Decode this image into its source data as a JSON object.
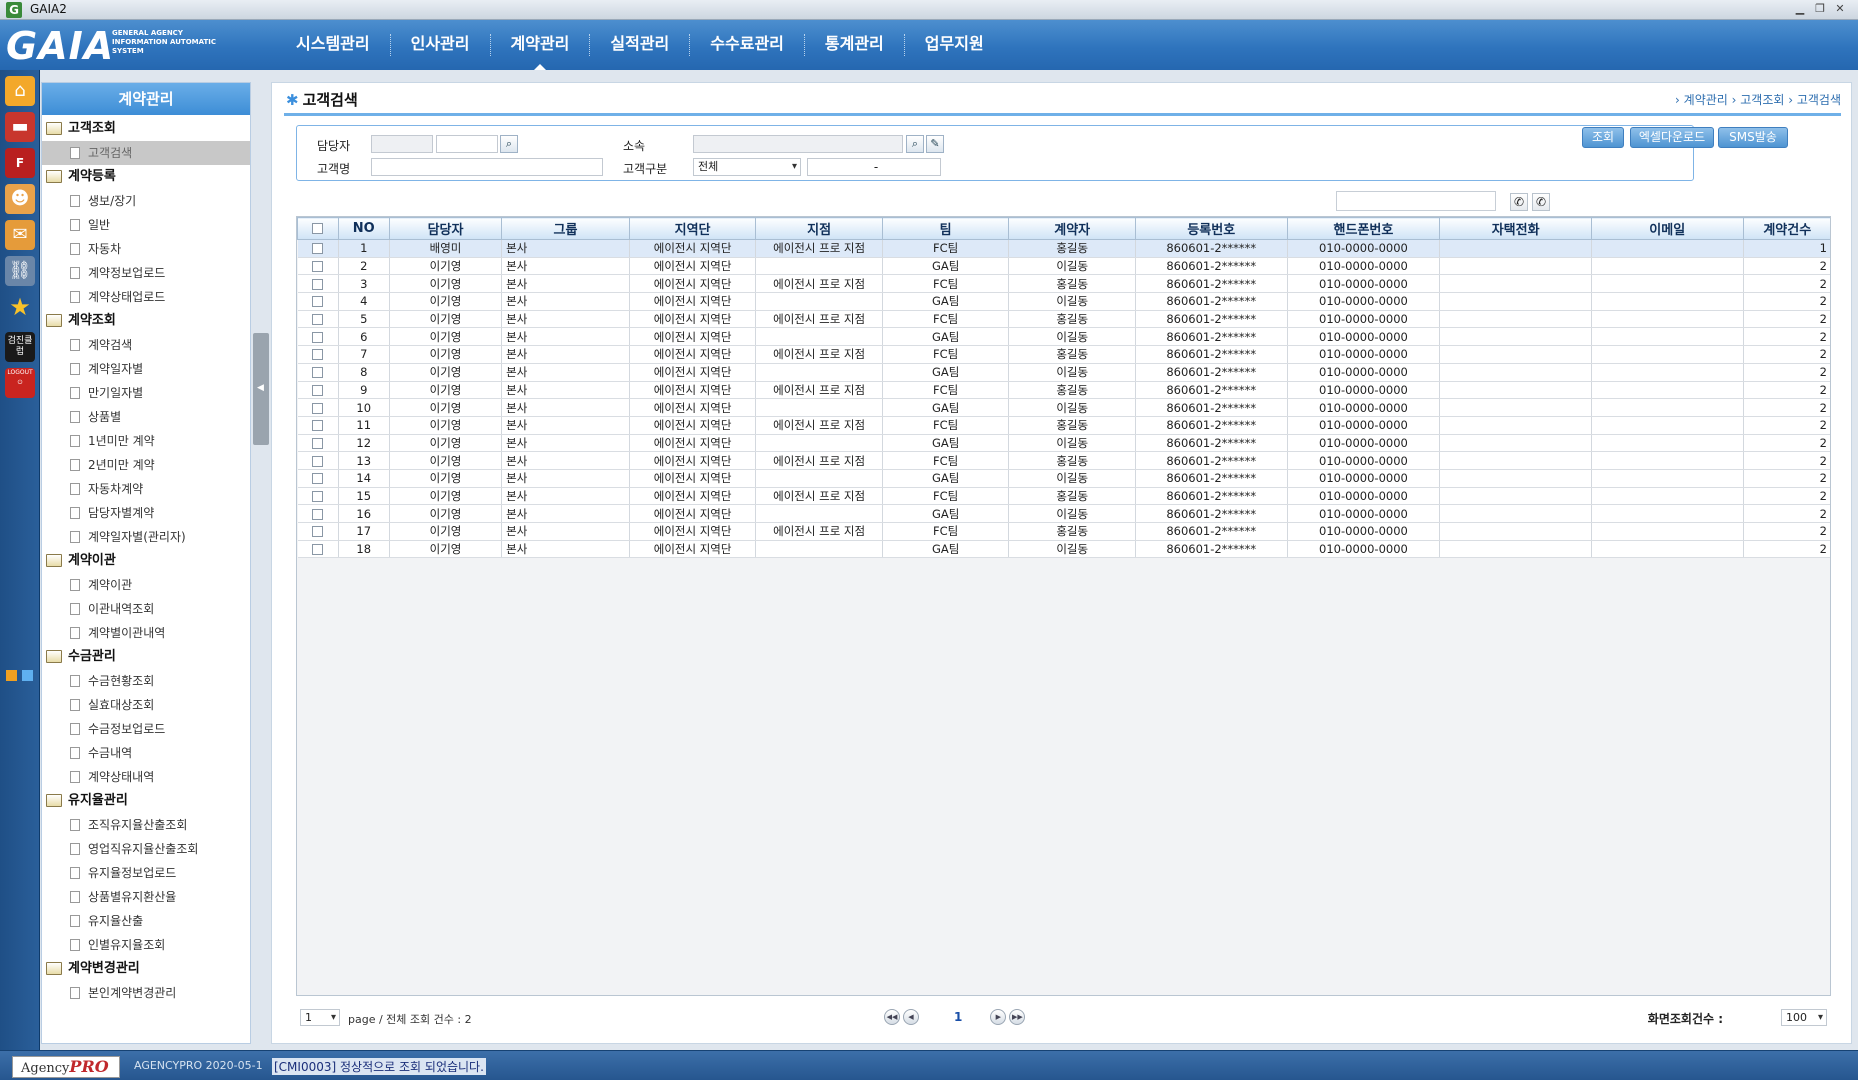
{
  "window": {
    "title": "GAIA2",
    "app_icon": "G"
  },
  "header": {
    "logo_text": "GAIA",
    "logo_sub": [
      "GENERAL AGENCY",
      "INFORMATION AUTOMATIC",
      "SYSTEM"
    ],
    "nav": [
      "시스템관리",
      "인사관리",
      "계약관리",
      "실적관리",
      "수수료관리",
      "통계관리",
      "업무지원"
    ],
    "active_nav": "계약관리"
  },
  "left_icons": [
    "home-icon",
    "car-icon",
    "fm-icon",
    "people-icon",
    "mail-icon",
    "link-icon",
    "star-icon",
    "exam-icon",
    "logout-icon"
  ],
  "left_icon_labels": {
    "exam": "검진클럽",
    "logout": "LOGOUT"
  },
  "sidebar": {
    "title": "계약관리",
    "groups": [
      {
        "label": "고객조회",
        "items": [
          "고객검색"
        ]
      },
      {
        "label": "계약등록",
        "items": [
          "생보/장기",
          "일반",
          "자동차",
          "계약정보업로드",
          "계약상태업로드"
        ]
      },
      {
        "label": "계약조회",
        "items": [
          "계약검색",
          "계약일자별",
          "만기일자별",
          "상품별",
          "1년미만 계약",
          "2년미만 계약",
          "자동차계약",
          "담당자별계약",
          "계약일자별(관리자)"
        ]
      },
      {
        "label": "계약이관",
        "items": [
          "계약이관",
          "이관내역조회",
          "계약별이관내역"
        ]
      },
      {
        "label": "수금관리",
        "items": [
          "수금현황조회",
          "실효대상조회",
          "수금정보업로드",
          "수금내역",
          "계약상태내역"
        ]
      },
      {
        "label": "유지율관리",
        "items": [
          "조직유지율산출조회",
          "영업직유지율산출조회",
          "유지율정보업로드",
          "상품별유지환산율",
          "유지율산출",
          "인별유지율조회"
        ]
      },
      {
        "label": "계약변경관리",
        "items": [
          "본인계약변경관리"
        ]
      }
    ],
    "selected": "고객검색"
  },
  "page": {
    "title": "고객검색",
    "breadcrumb": "› 계약관리 › 고객조회 › 고객검색"
  },
  "search": {
    "manager_label": "담당자",
    "affiliation_label": "소속",
    "customer_name_label": "고객명",
    "customer_type_label": "고객구분",
    "customer_type_value": "전체",
    "dash": "-",
    "buttons": {
      "search": "조회",
      "excel": "엑셀다운로드",
      "sms": "SMS발송"
    }
  },
  "table": {
    "columns": [
      "NO",
      "담당자",
      "그룹",
      "지역단",
      "지점",
      "팀",
      "계약자",
      "등록번호",
      "핸드폰번호",
      "자택전화",
      "이메일",
      "계약건수"
    ],
    "rows": [
      [
        "1",
        "배영미",
        "본사",
        "에이전시 지역단",
        "에이전시 프로 지점",
        "FC팀",
        "홍길동",
        "860601-2******",
        "010-0000-0000",
        "",
        "",
        "1"
      ],
      [
        "2",
        "이기영",
        "본사",
        "에이전시 지역단",
        "",
        "GA팀",
        "이길동",
        "860601-2******",
        "010-0000-0000",
        "",
        "",
        "2"
      ],
      [
        "3",
        "이기영",
        "본사",
        "에이전시 지역단",
        "에이전시 프로 지점",
        "FC팀",
        "홍길동",
        "860601-2******",
        "010-0000-0000",
        "",
        "",
        "2"
      ],
      [
        "4",
        "이기영",
        "본사",
        "에이전시 지역단",
        "",
        "GA팀",
        "이길동",
        "860601-2******",
        "010-0000-0000",
        "",
        "",
        "2"
      ],
      [
        "5",
        "이기영",
        "본사",
        "에이전시 지역단",
        "에이전시 프로 지점",
        "FC팀",
        "홍길동",
        "860601-2******",
        "010-0000-0000",
        "",
        "",
        "2"
      ],
      [
        "6",
        "이기영",
        "본사",
        "에이전시 지역단",
        "",
        "GA팀",
        "이길동",
        "860601-2******",
        "010-0000-0000",
        "",
        "",
        "2"
      ],
      [
        "7",
        "이기영",
        "본사",
        "에이전시 지역단",
        "에이전시 프로 지점",
        "FC팀",
        "홍길동",
        "860601-2******",
        "010-0000-0000",
        "",
        "",
        "2"
      ],
      [
        "8",
        "이기영",
        "본사",
        "에이전시 지역단",
        "",
        "GA팀",
        "이길동",
        "860601-2******",
        "010-0000-0000",
        "",
        "",
        "2"
      ],
      [
        "9",
        "이기영",
        "본사",
        "에이전시 지역단",
        "에이전시 프로 지점",
        "FC팀",
        "홍길동",
        "860601-2******",
        "010-0000-0000",
        "",
        "",
        "2"
      ],
      [
        "10",
        "이기영",
        "본사",
        "에이전시 지역단",
        "",
        "GA팀",
        "이길동",
        "860601-2******",
        "010-0000-0000",
        "",
        "",
        "2"
      ],
      [
        "11",
        "이기영",
        "본사",
        "에이전시 지역단",
        "에이전시 프로 지점",
        "FC팀",
        "홍길동",
        "860601-2******",
        "010-0000-0000",
        "",
        "",
        "2"
      ],
      [
        "12",
        "이기영",
        "본사",
        "에이전시 지역단",
        "",
        "GA팀",
        "이길동",
        "860601-2******",
        "010-0000-0000",
        "",
        "",
        "2"
      ],
      [
        "13",
        "이기영",
        "본사",
        "에이전시 지역단",
        "에이전시 프로 지점",
        "FC팀",
        "홍길동",
        "860601-2******",
        "010-0000-0000",
        "",
        "",
        "2"
      ],
      [
        "14",
        "이기영",
        "본사",
        "에이전시 지역단",
        "",
        "GA팀",
        "이길동",
        "860601-2******",
        "010-0000-0000",
        "",
        "",
        "2"
      ],
      [
        "15",
        "이기영",
        "본사",
        "에이전시 지역단",
        "에이전시 프로 지점",
        "FC팀",
        "홍길동",
        "860601-2******",
        "010-0000-0000",
        "",
        "",
        "2"
      ],
      [
        "16",
        "이기영",
        "본사",
        "에이전시 지역단",
        "",
        "GA팀",
        "이길동",
        "860601-2******",
        "010-0000-0000",
        "",
        "",
        "2"
      ],
      [
        "17",
        "이기영",
        "본사",
        "에이전시 지역단",
        "에이전시 프로 지점",
        "FC팀",
        "홍길동",
        "860601-2******",
        "010-0000-0000",
        "",
        "",
        "2"
      ],
      [
        "18",
        "이기영",
        "본사",
        "에이전시 지역단",
        "",
        "GA팀",
        "이길동",
        "860601-2******",
        "010-0000-0000",
        "",
        "",
        "2"
      ]
    ]
  },
  "pager": {
    "page_select": "1",
    "info": "page / 전체 조회 건수 : 2",
    "current_page": "1",
    "count_label": "화면조회건수 :",
    "count_value": "100"
  },
  "status": {
    "agency_text": "Agency",
    "agency_pro": "PRO",
    "version": "AGENCYPRO 2020-05-1",
    "message": "[CMI0003] 정상적으로 조회 되었습니다."
  },
  "colors": {
    "brand_blue": "#2f74bd",
    "left_bar": "#1f4f86",
    "accent": "#6fb0e8"
  }
}
